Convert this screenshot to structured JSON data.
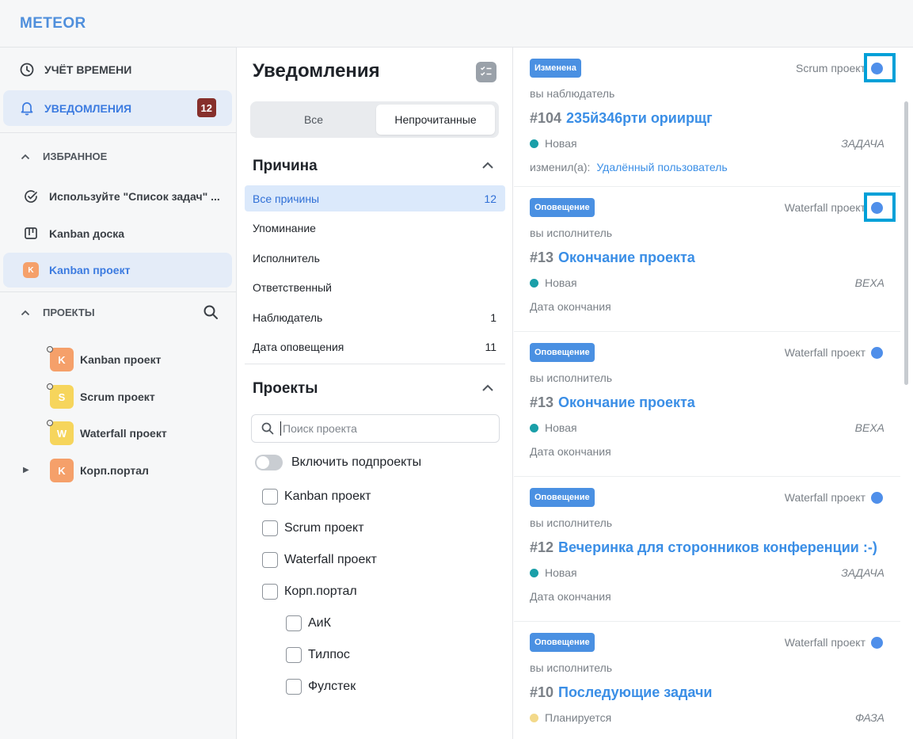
{
  "app": {
    "logo": "METEOR"
  },
  "sidebar": {
    "nav": [
      {
        "label": "УЧЁТ ВРЕМЕНИ",
        "icon": "clock-icon"
      },
      {
        "label": "УВЕДОМЛЕНИЯ",
        "icon": "bell-icon",
        "badge": "12",
        "active": true
      }
    ],
    "favorites": {
      "title": "ИЗБРАННОЕ",
      "items": [
        {
          "label": "Используйте \"Список задач\" ...",
          "icon": "check-circle-icon"
        },
        {
          "label": "Kanban доска",
          "icon": "kanban-board-icon"
        },
        {
          "label": "Kanban проект",
          "icon": "project-k-icon",
          "letter": "K",
          "active": true
        }
      ]
    },
    "projects": {
      "title": "ПРОЕКТЫ",
      "items": [
        {
          "label": "Kanban проект",
          "letter": "K",
          "color": "#f5a06a"
        },
        {
          "label": "Scrum проект",
          "letter": "S",
          "color": "#f6d55c"
        },
        {
          "label": "Waterfall проект",
          "letter": "W",
          "color": "#f6d55c"
        },
        {
          "label": "Корп.портал",
          "letter": "K",
          "color": "#f5a06a"
        }
      ]
    }
  },
  "filters": {
    "title": "Уведомления",
    "tabs": {
      "all": "Все",
      "unread": "Непрочитанные"
    },
    "reasons": {
      "title": "Причина",
      "items": [
        {
          "label": "Все причины",
          "count": "12",
          "selected": true
        },
        {
          "label": "Упоминание",
          "count": ""
        },
        {
          "label": "Исполнитель",
          "count": ""
        },
        {
          "label": "Ответственный",
          "count": ""
        },
        {
          "label": "Наблюдатель",
          "count": "1"
        },
        {
          "label": "Дата оповещения",
          "count": "11"
        }
      ]
    },
    "projects": {
      "title": "Проекты",
      "search_placeholder": "Поиск проекта",
      "include_subprojects": "Включить подпроекты",
      "checkboxes": [
        "Kanban проект",
        "Scrum проект",
        "Waterfall проект",
        "Корп.портал"
      ],
      "subcheckboxes": [
        "АиК",
        "Тилпос",
        "Фулстек"
      ]
    }
  },
  "feed": {
    "items": [
      {
        "tag": "Изменена",
        "project": "Scrum проект",
        "role": "вы наблюдатель",
        "number": "#104",
        "title": "235й346рти ориирщг",
        "status": "Новая",
        "status_color": "#1a9fa8",
        "type": "ЗАДАЧА",
        "footer": "изменил(а):",
        "user": "Удалённый пользователь"
      },
      {
        "tag": "Оповещение",
        "project": "Waterfall проект",
        "role": "вы исполнитель",
        "number": "#13",
        "title": "Окончание проекта",
        "status": "Новая",
        "status_color": "#1a9fa8",
        "type": "ВЕХА",
        "footer": "Дата окончания"
      },
      {
        "tag": "Оповещение",
        "project": "Waterfall проект",
        "role": "вы исполнитель",
        "number": "#13",
        "title": "Окончание проекта",
        "status": "Новая",
        "status_color": "#1a9fa8",
        "type": "ВЕХА",
        "footer": "Дата окончания"
      },
      {
        "tag": "Оповещение",
        "project": "Waterfall проект",
        "role": "вы исполнитель",
        "number": "#12",
        "title": "Вечеринка для сторонников конференции :-)",
        "status": "Новая",
        "status_color": "#1a9fa8",
        "type": "ЗАДАЧА",
        "footer": "Дата окончания"
      },
      {
        "tag": "Оповещение",
        "project": "Waterfall проект",
        "role": "вы исполнитель",
        "number": "#10",
        "title": "Последующие задачи",
        "status": "Планируется",
        "status_color": "#f3d98a",
        "type": "ФАЗА",
        "footer": ""
      }
    ]
  }
}
